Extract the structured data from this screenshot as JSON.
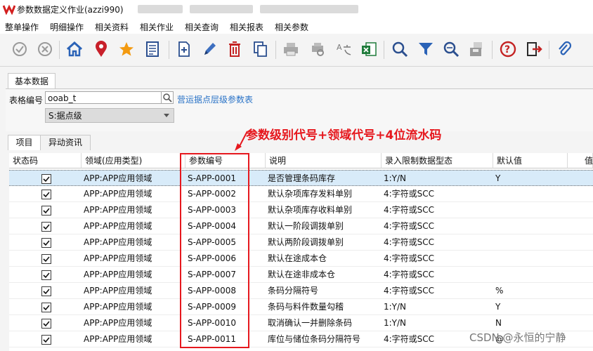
{
  "window": {
    "title": "参数数据定义作业(azzi990)"
  },
  "menu": [
    "整单操作",
    "明细操作",
    "相关资料",
    "相关作业",
    "相关查询",
    "相关报表",
    "相关参数"
  ],
  "toolbar_icons": [
    "confirm-icon",
    "cancel-icon",
    "home-icon",
    "location-pin-icon",
    "star-icon",
    "list-doc-icon",
    "new-icon",
    "edit-icon",
    "delete-icon",
    "copy-icon",
    "print-icon",
    "print-preview-icon",
    "translate-icon",
    "excel-export-icon",
    "search-icon",
    "filter-icon",
    "advanced-search-icon",
    "save-query-icon",
    "help-icon",
    "exit-icon",
    "attachment-icon"
  ],
  "basic_tab": {
    "label": "基本数据"
  },
  "form": {
    "code_label": "表格编号",
    "code_value": "ooab_t",
    "code_desc": "营运据点层级参数表",
    "level_value": "S:据点级"
  },
  "detail_tabs": [
    "项目",
    "异动资讯"
  ],
  "grid": {
    "columns": [
      "状态码",
      "领域(应用类型)",
      "参数编号",
      "说明",
      "录入限制数据型态",
      "默认值",
      "值"
    ],
    "rows": [
      {
        "checked": true,
        "domain": "APP:APP应用领域",
        "code": "S-APP-0001",
        "desc": "是否管理条码库存",
        "type": "1:Y/N",
        "default": "Y"
      },
      {
        "checked": true,
        "domain": "APP:APP应用领域",
        "code": "S-APP-0002",
        "desc": "默认杂项库存发料单别",
        "type": "4:字符或SCC",
        "default": ""
      },
      {
        "checked": true,
        "domain": "APP:APP应用领域",
        "code": "S-APP-0003",
        "desc": "默认杂项库存收料单别",
        "type": "4:字符或SCC",
        "default": ""
      },
      {
        "checked": true,
        "domain": "APP:APP应用领域",
        "code": "S-APP-0004",
        "desc": "默认一阶段调拨单别",
        "type": "4:字符或SCC",
        "default": ""
      },
      {
        "checked": true,
        "domain": "APP:APP应用领域",
        "code": "S-APP-0005",
        "desc": "默认两阶段调拨单别",
        "type": "4:字符或SCC",
        "default": ""
      },
      {
        "checked": true,
        "domain": "APP:APP应用领域",
        "code": "S-APP-0006",
        "desc": "默认在途成本仓",
        "type": "4:字符或SCC",
        "default": ""
      },
      {
        "checked": true,
        "domain": "APP:APP应用领域",
        "code": "S-APP-0007",
        "desc": "默认在途非成本仓",
        "type": "4:字符或SCC",
        "default": ""
      },
      {
        "checked": true,
        "domain": "APP:APP应用领域",
        "code": "S-APP-0008",
        "desc": "条码分隔符号",
        "type": "4:字符或SCC",
        "default": "%"
      },
      {
        "checked": true,
        "domain": "APP:APP应用领域",
        "code": "S-APP-0009",
        "desc": "条码与料件数量勾稽",
        "type": "1:Y/N",
        "default": "Y"
      },
      {
        "checked": true,
        "domain": "APP:APP应用领域",
        "code": "S-APP-0010",
        "desc": "取消确认一并删除条码",
        "type": "1:Y/N",
        "default": "N"
      },
      {
        "checked": true,
        "domain": "APP:APP应用领域",
        "code": "S-APP-0011",
        "desc": "库位与储位条码分隔符号",
        "type": "4:字符或SCC",
        "default": "@"
      }
    ]
  },
  "annotation": {
    "text": "参数级别代号+领域代号+4位流水码",
    "color": "#e6181e"
  },
  "watermark": "CSDN @永恒的宁静"
}
